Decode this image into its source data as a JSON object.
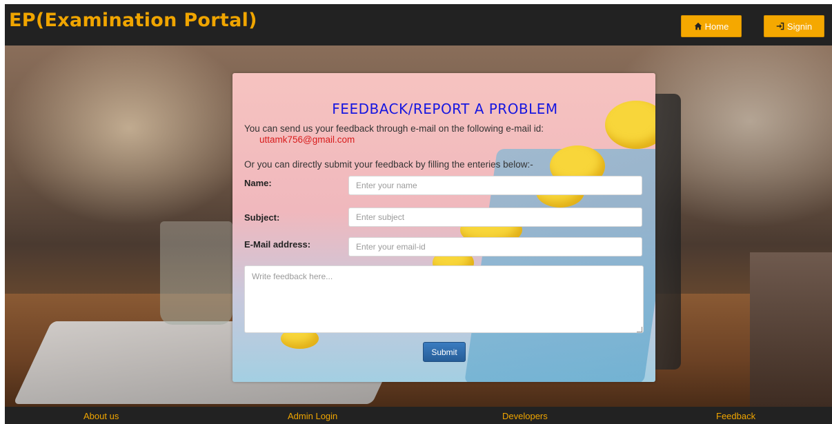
{
  "header": {
    "brand": "EP(Examination Portal)",
    "home_label": "Home",
    "signin_label": "Signin"
  },
  "feedback": {
    "title": "FEEDBACK/REPORT A PROBLEM",
    "intro": "You can send us your feedback through e-mail on the following e-mail id:",
    "email": "uttamk756@gmail.com",
    "intro2": "Or you can directly submit your feedback by filling the enteries below:-",
    "name_label": "Name:",
    "name_placeholder": "Enter your name",
    "subject_label": "Subject:",
    "subject_placeholder": "Enter subject",
    "email_label": "E-Mail address:",
    "email_placeholder": "Enter your email-id",
    "message_placeholder": "Write feedback here...",
    "submit_label": "Submit"
  },
  "footer": {
    "links": [
      "About us",
      "Admin Login",
      "Developers",
      "Feedback"
    ]
  },
  "colors": {
    "brand": "#f0a500",
    "title": "#1616e0",
    "email": "#d81b1b",
    "submit": "#265d98"
  },
  "icons": {
    "home": "home-icon",
    "signin": "sign-in-icon"
  }
}
